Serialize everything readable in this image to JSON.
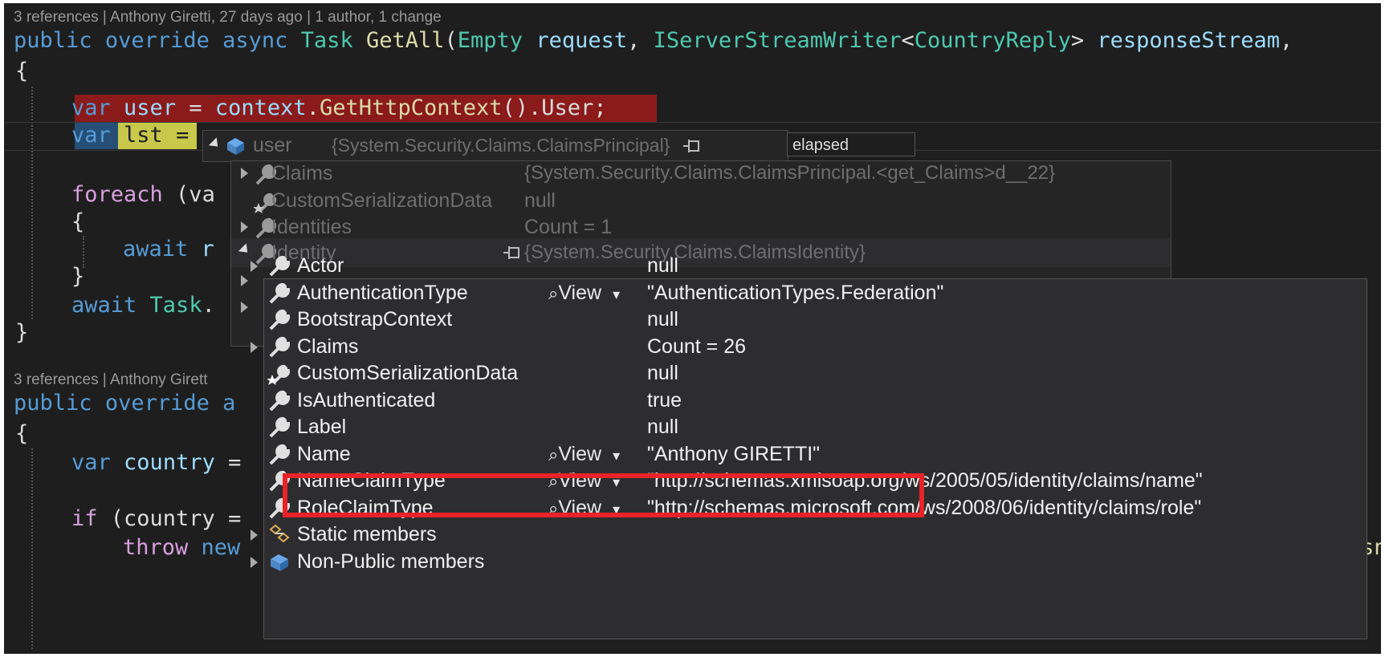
{
  "codelens": {
    "first": "3 references | Anthony Giretti, 27 days ago | 1 author, 1 change",
    "second": "3 references | Anthony Girett"
  },
  "code": {
    "l1_public": "public",
    "l1_override": "override",
    "l1_async": "async",
    "l1_task": "Task",
    "l1_getall": "GetAll",
    "l1_open": "(",
    "l1_empty": "Empty",
    "l1_request": "request",
    "l1_comma": ",",
    "l1_writer": "IServerStreamWriter",
    "l1_lt": "<",
    "l1_reply": "CountryReply",
    "l1_gt": ">",
    "l1_stream": "responseStream",
    "brace_open": "{",
    "l3_var": "var",
    "l3_user": "user",
    "l3_eq": "=",
    "l3_context": "context",
    "l3_dot1": ".",
    "l3_get": "GetHttpContext",
    "l3_paren": "().",
    "l3_userprop": "User",
    "l3_semi": ";",
    "l4_var": "var",
    "l4_lst": "lst",
    "l4_eq": "=",
    "l6_foreach": "foreach",
    "l6_rest": " (va",
    "l8_await": "await",
    "l8_rest": " r",
    "brace_close": "}",
    "l10_await": "await",
    "l10_task": "Task",
    "l10_dot": ".",
    "l13_public": "public",
    "l13_override": "override",
    "l13_a": "a",
    "l13_end": ")",
    "l15_var": "var",
    "l15_country": "country",
    "l15_eq": "=",
    "l17_if": "if",
    "l17_rest": " (country =",
    "l18_throw": "throw",
    "l18_new": "new",
    "l18_tail": "sn"
  },
  "datatip": {
    "var_name": "user",
    "var_value": "{System.Security.Claims.ClaimsPrincipal}",
    "elapsed_label": "elapsed",
    "rows": [
      {
        "name": "Claims",
        "value": "{System.Security.Claims.ClaimsPrincipal.<get_Claims>d__22}"
      },
      {
        "name": "CustomSerializationData",
        "value": "null"
      },
      {
        "name": "Identities",
        "value": "Count = 1"
      },
      {
        "name": "Identity",
        "value": "{System.Security.Claims.ClaimsIdentity}"
      }
    ]
  },
  "identity": {
    "view_label": "View",
    "rows": [
      {
        "name": "Actor",
        "value": "null"
      },
      {
        "name": "AuthenticationType",
        "value": "\"AuthenticationTypes.Federation\""
      },
      {
        "name": "BootstrapContext",
        "value": "null"
      },
      {
        "name": "Claims",
        "value": "Count = 26"
      },
      {
        "name": "CustomSerializationData",
        "value": "null"
      },
      {
        "name": "IsAuthenticated",
        "value": "true"
      },
      {
        "name": "Label",
        "value": "null"
      },
      {
        "name": "Name",
        "value": "\"Anthony GIRETTI\""
      },
      {
        "name": "NameClaimType",
        "value": "\"http://schemas.xmlsoap.org/ws/2005/05/identity/claims/name\""
      },
      {
        "name": "RoleClaimType",
        "value": "\"http://schemas.microsoft.com/ws/2008/06/identity/claims/role\""
      },
      {
        "name": "Static members",
        "value": ""
      },
      {
        "name": "Non-Public members",
        "value": ""
      }
    ]
  },
  "colors": {
    "highlight_box": "#e8232a",
    "breakpoint_line": "#8b1a1a",
    "editor_bg": "#1e1e1e"
  }
}
